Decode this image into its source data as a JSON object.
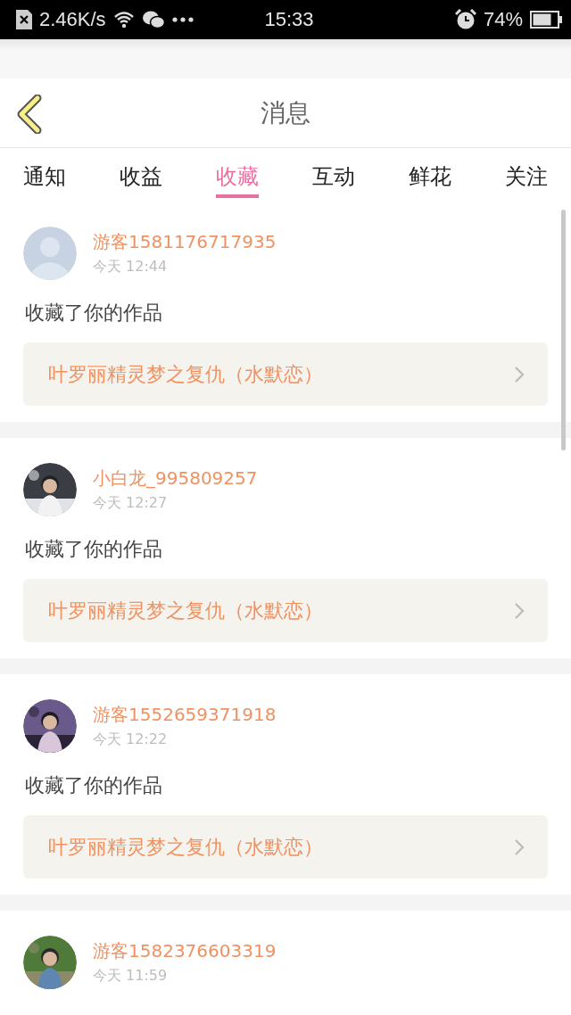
{
  "status_bar": {
    "speed": "2.46K/s",
    "time": "15:33",
    "battery": "74%"
  },
  "header": {
    "title": "消息"
  },
  "tabs": [
    {
      "label": "通知",
      "selected": false
    },
    {
      "label": "收益",
      "selected": false
    },
    {
      "label": "收藏",
      "selected": true
    },
    {
      "label": "互动",
      "selected": false
    },
    {
      "label": "鲜花",
      "selected": false
    },
    {
      "label": "关注",
      "selected": false
    }
  ],
  "messages": [
    {
      "avatar": {
        "kind": "default"
      },
      "user": "游客1581176717935",
      "time": "今天 12:44",
      "action": "收藏了你的作品",
      "work": "叶罗丽精灵梦之复仇（水默恋）"
    },
    {
      "user": "小白龙_995809257",
      "time": "今天 12:27",
      "action": "收藏了你的作品",
      "work": "叶罗丽精灵梦之复仇（水默恋）"
    },
    {
      "user": "游客1552659371918",
      "time": "今天 12:22",
      "action": "收藏了你的作品",
      "work": "叶罗丽精灵梦之复仇（水默恋）"
    },
    {
      "user": "游客1582376603319",
      "time": "今天 11:59"
    }
  ]
}
